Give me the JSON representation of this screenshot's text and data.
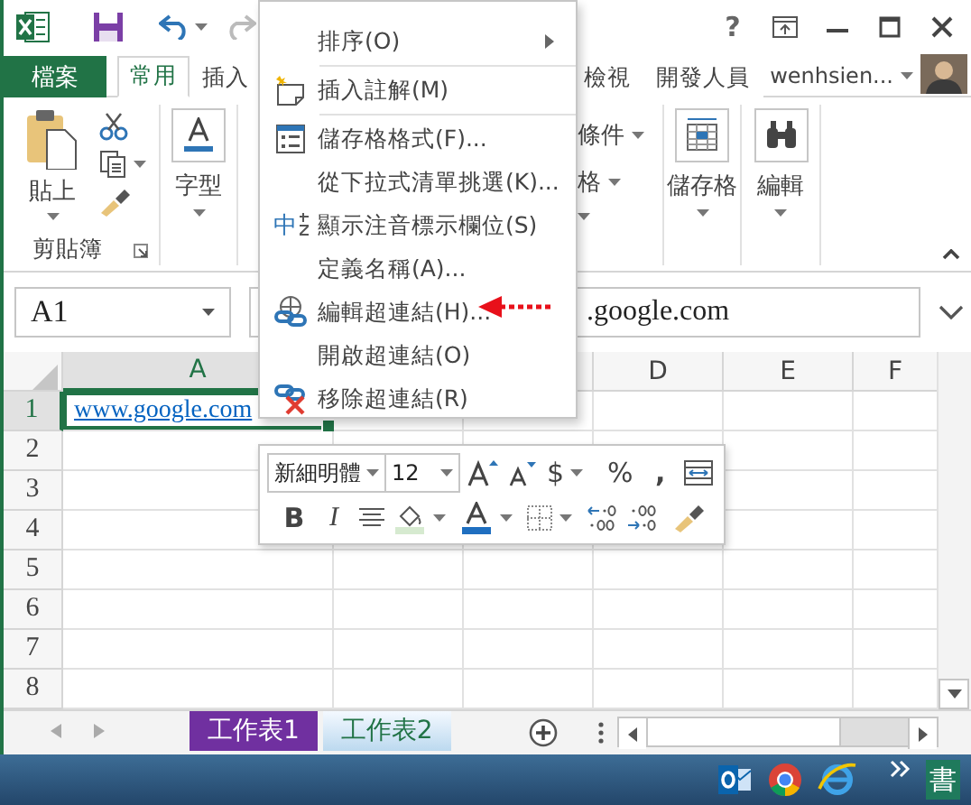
{
  "title_bar": {
    "help": "?"
  },
  "ribbon_tabs_left": [
    {
      "label": "檔案",
      "kind": "file",
      "selected": false
    },
    {
      "label": "常用",
      "kind": "tab",
      "selected": true
    },
    {
      "label": "插入",
      "kind": "tab",
      "selected": false
    }
  ],
  "ribbon_tabs_right": [
    {
      "label": "檢視",
      "kind": "tab",
      "selected": false
    },
    {
      "label": "開發人員",
      "kind": "tab",
      "selected": false
    }
  ],
  "account": {
    "name": "wenhsien..."
  },
  "ribbon": {
    "paste": "貼上",
    "clipboard_group": "剪貼簿",
    "font_group": "字型",
    "styles_items": [
      "條件",
      "格"
    ],
    "cells_group": "儲存格",
    "editing_group": "編輯"
  },
  "name_box": "A1",
  "formula": ".google.com",
  "columns": [
    {
      "label": "A",
      "selected": true
    },
    {
      "label": "D",
      "selected": false
    },
    {
      "label": "E",
      "selected": false
    },
    {
      "label": "F",
      "selected": false
    }
  ],
  "rows": [
    {
      "header": "1",
      "selected": true,
      "cells": [
        {
          "text": "www.google.com",
          "kind": "link",
          "selected": true
        }
      ]
    },
    {
      "header": "2",
      "selected": false,
      "cells": []
    },
    {
      "header": "3",
      "selected": false,
      "cells": []
    },
    {
      "header": "4",
      "selected": false,
      "cells": []
    },
    {
      "header": "5",
      "selected": false,
      "cells": []
    },
    {
      "header": "6",
      "selected": false,
      "cells": []
    },
    {
      "header": "7",
      "selected": false,
      "cells": []
    },
    {
      "header": "8",
      "selected": false,
      "cells": []
    }
  ],
  "sheet_tabs": [
    {
      "label": "工作表1",
      "selected": true
    },
    {
      "label": "工作表2",
      "selected": false
    }
  ],
  "context_menu": [
    {
      "kind": "plain",
      "label": "排序(O)",
      "submenu": true
    },
    {
      "kind": "separator"
    },
    {
      "kind": "comment",
      "label": "插入註解(M)",
      "submenu": false
    },
    {
      "kind": "separator"
    },
    {
      "kind": "format-cells",
      "label": "儲存格格式(F)...",
      "submenu": false
    },
    {
      "kind": "plain",
      "label": "從下拉式清單挑選(K)...",
      "submenu": false
    },
    {
      "kind": "phonetic",
      "label": "顯示注音標示欄位(S)",
      "icon_text": "中",
      "submenu": false
    },
    {
      "kind": "plain",
      "label": "定義名稱(A)...",
      "submenu": false
    },
    {
      "kind": "edit-link",
      "label": "編輯超連結(H)...",
      "submenu": false
    },
    {
      "kind": "plain",
      "label": "開啟超連結(O)",
      "submenu": false
    },
    {
      "kind": "remove-link",
      "label": "移除超連結(R)",
      "submenu": false
    }
  ],
  "mini_toolbar": {
    "font": "新細明體",
    "size": "12",
    "currency": "$",
    "percent": "%",
    "comma": ",",
    "bold": "B",
    "italic": "I"
  },
  "taskbar": {
    "ime": "書"
  }
}
